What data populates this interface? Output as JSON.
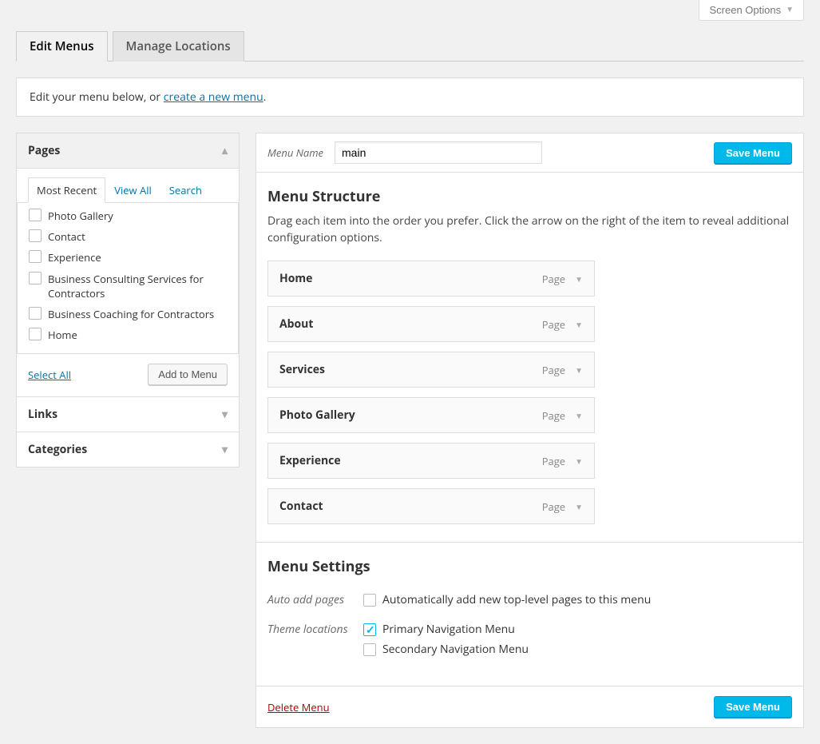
{
  "screen_options_label": "Screen Options",
  "tabs": {
    "edit": "Edit Menus",
    "locations": "Manage Locations"
  },
  "intro": {
    "prefix": "Edit your menu below, or ",
    "link": "create a new menu",
    "suffix": "."
  },
  "accordion": {
    "pages": {
      "title": "Pages",
      "inner_tabs": {
        "recent": "Most Recent",
        "view_all": "View All",
        "search": "Search"
      },
      "items": [
        "Photo Gallery",
        "Contact",
        "Experience",
        "Business Consulting Services for Contractors",
        "Business Coaching for Contractors",
        "Home"
      ],
      "select_all": "Select All",
      "add_btn": "Add to Menu"
    },
    "links": {
      "title": "Links"
    },
    "categories": {
      "title": "Categories"
    }
  },
  "menu": {
    "name_label": "Menu Name",
    "name_value": "main",
    "save_btn": "Save Menu",
    "structure_title": "Menu Structure",
    "structure_desc": "Drag each item into the order you prefer. Click the arrow on the right of the item to reveal additional configuration options.",
    "type_label": "Page",
    "items": [
      {
        "title": "Home"
      },
      {
        "title": "About"
      },
      {
        "title": "Services"
      },
      {
        "title": "Photo Gallery"
      },
      {
        "title": "Experience"
      },
      {
        "title": "Contact"
      }
    ],
    "settings_title": "Menu Settings",
    "auto_add_label": "Auto add pages",
    "auto_add_option": "Automatically add new top-level pages to this menu",
    "theme_loc_label": "Theme locations",
    "theme_loc_options": [
      {
        "label": "Primary Navigation Menu",
        "checked": true
      },
      {
        "label": "Secondary Navigation Menu",
        "checked": false
      }
    ],
    "delete": "Delete Menu"
  }
}
